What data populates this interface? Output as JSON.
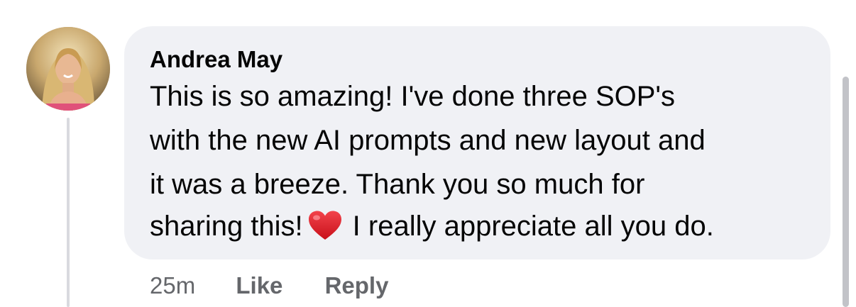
{
  "comment": {
    "author": "Andrea May",
    "text_lines": [
      "This is so amazing! I've done three SOP's",
      "with the new AI prompts and new layout and",
      "it was a breeze. Thank you so much for",
      "sharing this!",
      "I really appreciate all you do."
    ],
    "emoji": "red-heart",
    "timestamp": "25m",
    "like_label": "Like",
    "reply_label": "Reply"
  },
  "colors": {
    "bubble_background": "#f0f1f5",
    "text_primary": "#050505",
    "text_secondary": "#65676b",
    "heart": "#e0242c"
  },
  "icons": {
    "avatar": "profile-photo",
    "heart": "red-heart-emoji"
  }
}
